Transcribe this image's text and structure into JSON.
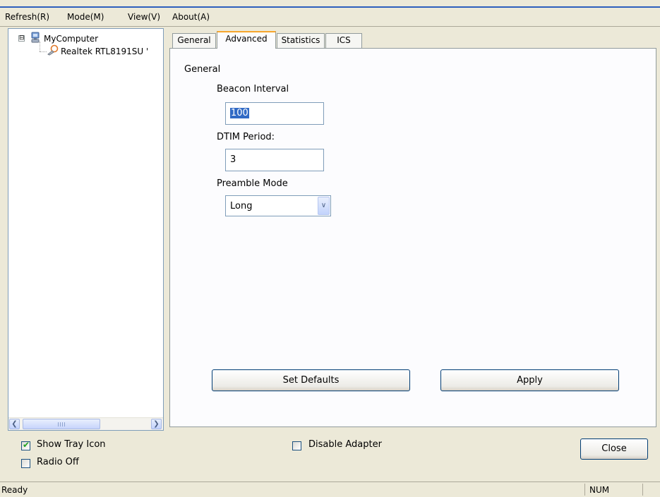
{
  "menu": {
    "items": [
      "Refresh(R)",
      "Mode(M)",
      "View(V)",
      "About(A)"
    ]
  },
  "tree": {
    "root_label": "MyComputer",
    "root_icon": "computer-icon",
    "expander": "⊟",
    "child_label": "Realtek RTL8191SU '",
    "child_icon": "wireless-adapter-icon"
  },
  "tabs": [
    "General",
    "Advanced",
    "Statistics",
    "ICS"
  ],
  "active_tab": "Advanced",
  "advanced": {
    "group_label": "General",
    "beacon_interval_label": "Beacon Interval",
    "beacon_interval_value": "100",
    "dtim_period_label": "DTIM Period:",
    "dtim_period_value": "3",
    "preamble_mode_label": "Preamble Mode",
    "preamble_mode_value": "Long",
    "set_defaults_label": "Set Defaults",
    "apply_label": "Apply"
  },
  "bottom": {
    "show_tray_icon_label": "Show Tray Icon",
    "show_tray_icon_checked": true,
    "radio_off_label": "Radio Off",
    "radio_off_checked": false,
    "disable_adapter_label": "Disable Adapter",
    "disable_adapter_checked": false,
    "close_label": "Close"
  },
  "status": {
    "text": "Ready",
    "num": "NUM"
  },
  "colors": {
    "window_bg": "#ece9d8",
    "active_tab_accent": "#f7a62d",
    "selection": "#316ac5",
    "check_mark": "#21a121"
  }
}
